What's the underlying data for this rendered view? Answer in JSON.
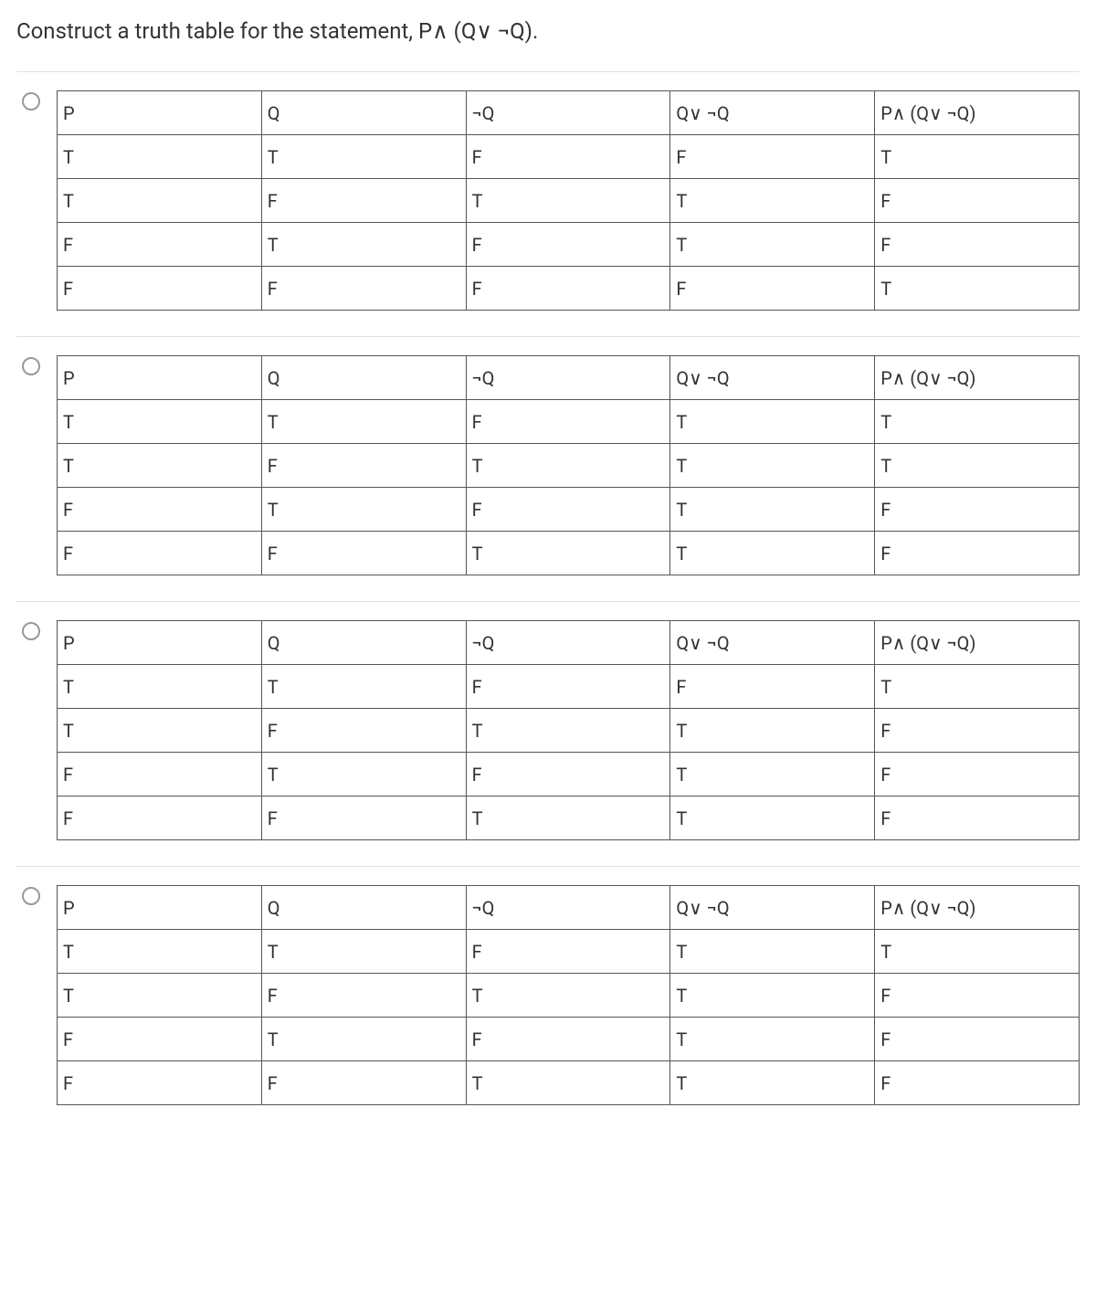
{
  "question": "Construct a truth table for the statement, P∧ (Q∨ ¬Q).",
  "headers": [
    "P",
    "Q",
    "¬Q",
    "Q∨ ¬Q",
    "P∧ (Q∨ ¬Q)"
  ],
  "options": [
    {
      "rows": [
        [
          "T",
          "T",
          "F",
          "F",
          "T"
        ],
        [
          "T",
          "F",
          "T",
          "T",
          "F"
        ],
        [
          "F",
          "T",
          "F",
          "T",
          "F"
        ],
        [
          "F",
          "F",
          "F",
          "F",
          "T"
        ]
      ]
    },
    {
      "rows": [
        [
          "T",
          "T",
          "F",
          "T",
          "T"
        ],
        [
          "T",
          "F",
          "T",
          "T",
          "T"
        ],
        [
          "F",
          "T",
          "F",
          "T",
          "F"
        ],
        [
          "F",
          "F",
          "T",
          "T",
          "F"
        ]
      ]
    },
    {
      "rows": [
        [
          "T",
          "T",
          "F",
          "F",
          "T"
        ],
        [
          "T",
          "F",
          "T",
          "T",
          "F"
        ],
        [
          "F",
          "T",
          "F",
          "T",
          "F"
        ],
        [
          "F",
          "F",
          "T",
          "T",
          "F"
        ]
      ]
    },
    {
      "rows": [
        [
          "T",
          "T",
          "F",
          "T",
          "T"
        ],
        [
          "T",
          "F",
          "T",
          "T",
          "F"
        ],
        [
          "F",
          "T",
          "F",
          "T",
          "F"
        ],
        [
          "F",
          "F",
          "T",
          "T",
          "F"
        ]
      ]
    }
  ]
}
